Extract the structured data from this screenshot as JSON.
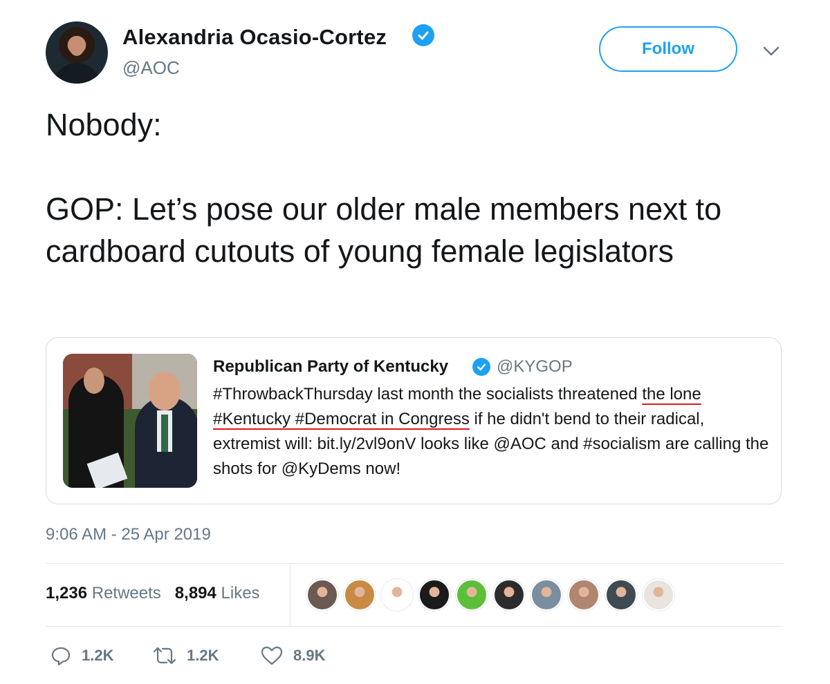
{
  "header": {
    "display_name": "Alexandria Ocasio-Cortez",
    "handle": "@AOC",
    "follow_label": "Follow"
  },
  "tweet": {
    "text": "Nobody:\n\nGOP: Let’s pose our older male members next to cardboard cutouts of young female legislators"
  },
  "quote": {
    "name": "Republican Party of Kentucky",
    "handle": "@KYGOP",
    "text_part1": "#ThrowbackThursday last month the socialists threatened ",
    "text_underlined": "the lone #Kentucky #Democrat in Congress",
    "text_part2": " if he didn't bend to their radical, extremist will: bit.ly/2vl9onV looks like @AOC and #socialism are calling the shots for @KyDems now!"
  },
  "timestamp": "9:06 AM - 25 Apr 2019",
  "stats": {
    "retweets_count": "1,236",
    "retweets_label": "Retweets",
    "likes_count": "8,894",
    "likes_label": "Likes"
  },
  "liker_avatar_colors": [
    "#6b5a52",
    "#c98a45",
    "#ffffff",
    "#1b1b1b",
    "#5bbf3a",
    "#2c2c2c",
    "#7a8ea0",
    "#b0866f",
    "#3f4a52",
    "#e9e4e0"
  ],
  "actions": {
    "reply_count": "1.2K",
    "retweet_count": "1.2K",
    "like_count": "8.9K"
  },
  "colors": {
    "accent": "#1da1f2",
    "secondary_text": "#657786",
    "underline": "#e0151b"
  }
}
